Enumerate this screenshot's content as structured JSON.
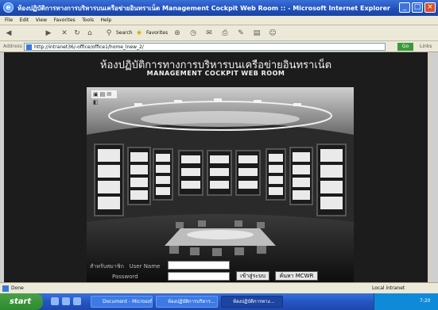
{
  "window": {
    "title": "ห้องปฏิบัติการทางการบริหารบนเครือข่ายอินทราเน็ต Management Cockpit Web Room :: - Microsoft Internet Explorer",
    "min": "_",
    "max": "□",
    "close": "×"
  },
  "menu": [
    "File",
    "Edit",
    "View",
    "Favorites",
    "Tools",
    "Help"
  ],
  "toolbar": {
    "search_label": "Search",
    "favorites_label": "Favorites"
  },
  "address": {
    "label": "Address",
    "url": "http://intranet36/-office/office1/home_lnew_2/",
    "go": "Go",
    "links": "Links"
  },
  "page": {
    "thai_title": "ห้องปฏิบัติการทางการบริหารบนเครือข่ายอินทราเน็ต",
    "english_title": "MANAGEMENT COCKPIT WEB ROOM",
    "login": {
      "user_prefix": "สำหรับสมาชิก",
      "user_label": "User Name",
      "password_label": "Password",
      "login_button": "เข้าสู่ระบบ",
      "search_button": "ค้นหา MCWR"
    }
  },
  "status": {
    "left": "Done",
    "zone": "Local intranet"
  },
  "taskbar": {
    "start": "start",
    "tasks": [
      "Document - Microsof...",
      "ห้องปฏิบัติการบริหาร...",
      "ห้องปฏิบัติการทาง..."
    ],
    "clock": "7:20"
  },
  "colors": {
    "title_blue": "#2456c4",
    "page_bg": "#1c1c1c",
    "taskbar_green": "#3c8f3c"
  }
}
